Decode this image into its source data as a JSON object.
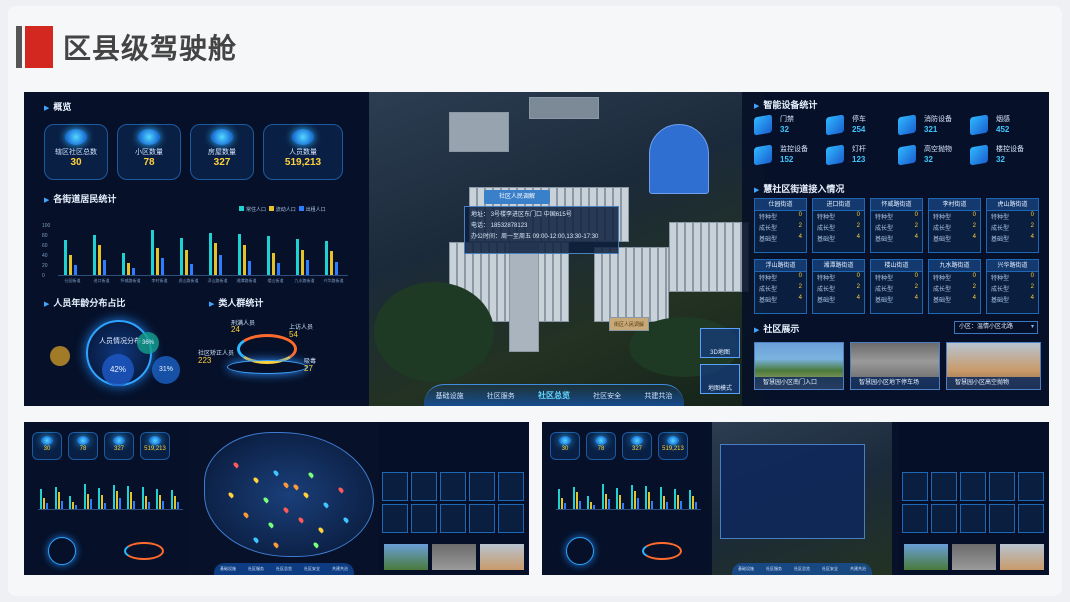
{
  "page": {
    "title": "区县级驾驶舱"
  },
  "main": {
    "left": {
      "overview_title": "概览",
      "stats": [
        {
          "label": "辖区社区总数",
          "value": "30",
          "icon": "community-icon"
        },
        {
          "label": "小区数量",
          "value": "78",
          "icon": "estate-icon"
        },
        {
          "label": "房屋数量",
          "value": "327",
          "icon": "house-icon"
        },
        {
          "label": "人员数量",
          "value": "519,213",
          "icon": "people-icon"
        }
      ],
      "residents_title": "各街道居民统计",
      "age_title": "人员年龄分布占比",
      "age_center": "人员情况分布",
      "age_pcts": [
        "42%",
        "31%",
        "36%"
      ],
      "groups_title": "类人群统计",
      "groups": [
        {
          "label": "刑满人员",
          "value": "24"
        },
        {
          "label": "上访人员",
          "value": "54"
        },
        {
          "label": "社区矫正人员",
          "value": "223"
        },
        {
          "label": "吸毒",
          "value": "27"
        }
      ]
    },
    "center": {
      "popup_title": "社区人民调解",
      "popup_lines": [
        "地址：",
        "电话：",
        "办公时间：周一至周五 09:00-12:00,13:30-17:30"
      ],
      "popup_phone": "18532878123",
      "popup_address": "3号楼李进区东门口 中国615号",
      "nav": [
        "基础设施",
        "社区服务",
        "社区总览",
        "社区安全",
        "共建共治"
      ],
      "nav_active_index": 2,
      "side_buttons": [
        "3D地图",
        "地图模式"
      ],
      "sign": "街区人民调解"
    },
    "right": {
      "devices_title": "智能设备统计",
      "devices": [
        {
          "label": "门禁",
          "value": "32",
          "icon": "door-icon"
        },
        {
          "label": "停车",
          "value": "254",
          "icon": "parking-icon"
        },
        {
          "label": "消防设备",
          "value": "321",
          "icon": "fire-icon"
        },
        {
          "label": "烟感",
          "value": "452",
          "icon": "smoke-icon"
        },
        {
          "label": "监控设备",
          "value": "152",
          "icon": "camera-icon"
        },
        {
          "label": "灯杆",
          "value": "123",
          "icon": "lamp-icon"
        },
        {
          "label": "高空抛物",
          "value": "32",
          "icon": "falling-icon"
        },
        {
          "label": "楼控设备",
          "value": "32",
          "icon": "building-icon"
        }
      ],
      "streets_title": "慧社区街道接入情况",
      "streets": [
        {
          "name": "仕园街道",
          "rows": [
            [
              "特种型",
              "0"
            ],
            [
              "成长型",
              "2"
            ],
            [
              "基础型",
              "4"
            ]
          ]
        },
        {
          "name": "进口街道",
          "rows": [
            [
              "特种型",
              "0"
            ],
            [
              "成长型",
              "2"
            ],
            [
              "基础型",
              "4"
            ]
          ]
        },
        {
          "name": "怀威路街道",
          "rows": [
            [
              "特种型",
              "0"
            ],
            [
              "成长型",
              "2"
            ],
            [
              "基础型",
              "4"
            ]
          ]
        },
        {
          "name": "李村街道",
          "rows": [
            [
              "特种型",
              "0"
            ],
            [
              "成长型",
              "2"
            ],
            [
              "基础型",
              "4"
            ]
          ]
        },
        {
          "name": "虎山路街道",
          "rows": [
            [
              "特种型",
              "0"
            ],
            [
              "成长型",
              "2"
            ],
            [
              "基础型",
              "4"
            ]
          ]
        },
        {
          "name": "浮山路街道",
          "rows": [
            [
              "特种型",
              "0"
            ],
            [
              "成长型",
              "2"
            ],
            [
              "基础型",
              "4"
            ]
          ]
        },
        {
          "name": "湘潭路街道",
          "rows": [
            [
              "特种型",
              "0"
            ],
            [
              "成长型",
              "2"
            ],
            [
              "基础型",
              "4"
            ]
          ]
        },
        {
          "name": "楼山街道",
          "rows": [
            [
              "特种型",
              "0"
            ],
            [
              "成长型",
              "2"
            ],
            [
              "基础型",
              "4"
            ]
          ]
        },
        {
          "name": "九水路街道",
          "rows": [
            [
              "特种型",
              "0"
            ],
            [
              "成长型",
              "2"
            ],
            [
              "基础型",
              "4"
            ]
          ]
        },
        {
          "name": "兴华路街道",
          "rows": [
            [
              "特种型",
              "0"
            ],
            [
              "成长型",
              "2"
            ],
            [
              "基础型",
              "4"
            ]
          ]
        }
      ],
      "show_title": "社区展示",
      "show_select": "小区：温情小区北路",
      "photos": [
        "智慧园小区南门入口",
        "智慧园小区地下停车场",
        "智慧园小区高空抛物"
      ]
    }
  },
  "chart_data": {
    "type": "bar",
    "title": "各街道居民统计",
    "ylim": [
      0,
      100
    ],
    "yticks": [
      "0",
      "20",
      "40",
      "60",
      "80",
      "100"
    ],
    "categories": [
      "仕园街道",
      "进口街道",
      "怀威路街道",
      "李村街道",
      "虎山路街道",
      "浮山路街道",
      "湘潭路街道",
      "楼山街道",
      "九水路街道",
      "兴华路街道"
    ],
    "legend": [
      "常住人口",
      "流动人口",
      "出租人口"
    ],
    "series": [
      {
        "name": "常住人口",
        "values": [
          70,
          80,
          45,
          90,
          75,
          85,
          82,
          78,
          72,
          68
        ]
      },
      {
        "name": "流动人口",
        "values": [
          40,
          60,
          25,
          55,
          50,
          65,
          60,
          45,
          50,
          48
        ]
      },
      {
        "name": "出租人口",
        "values": [
          20,
          30,
          15,
          35,
          22,
          40,
          28,
          25,
          30,
          26
        ]
      }
    ]
  },
  "thumbs": {
    "a": {
      "stats": [
        "30",
        "78",
        "327",
        "519,213"
      ],
      "nav": [
        "基础设施",
        "社区服务",
        "社区总览",
        "社区安全",
        "共建共治"
      ]
    },
    "b": {
      "stats": [
        "30",
        "78",
        "327",
        "519,213"
      ],
      "nav": [
        "基础设施",
        "社区服务",
        "社区总览",
        "社区安全",
        "共建共治"
      ]
    }
  }
}
